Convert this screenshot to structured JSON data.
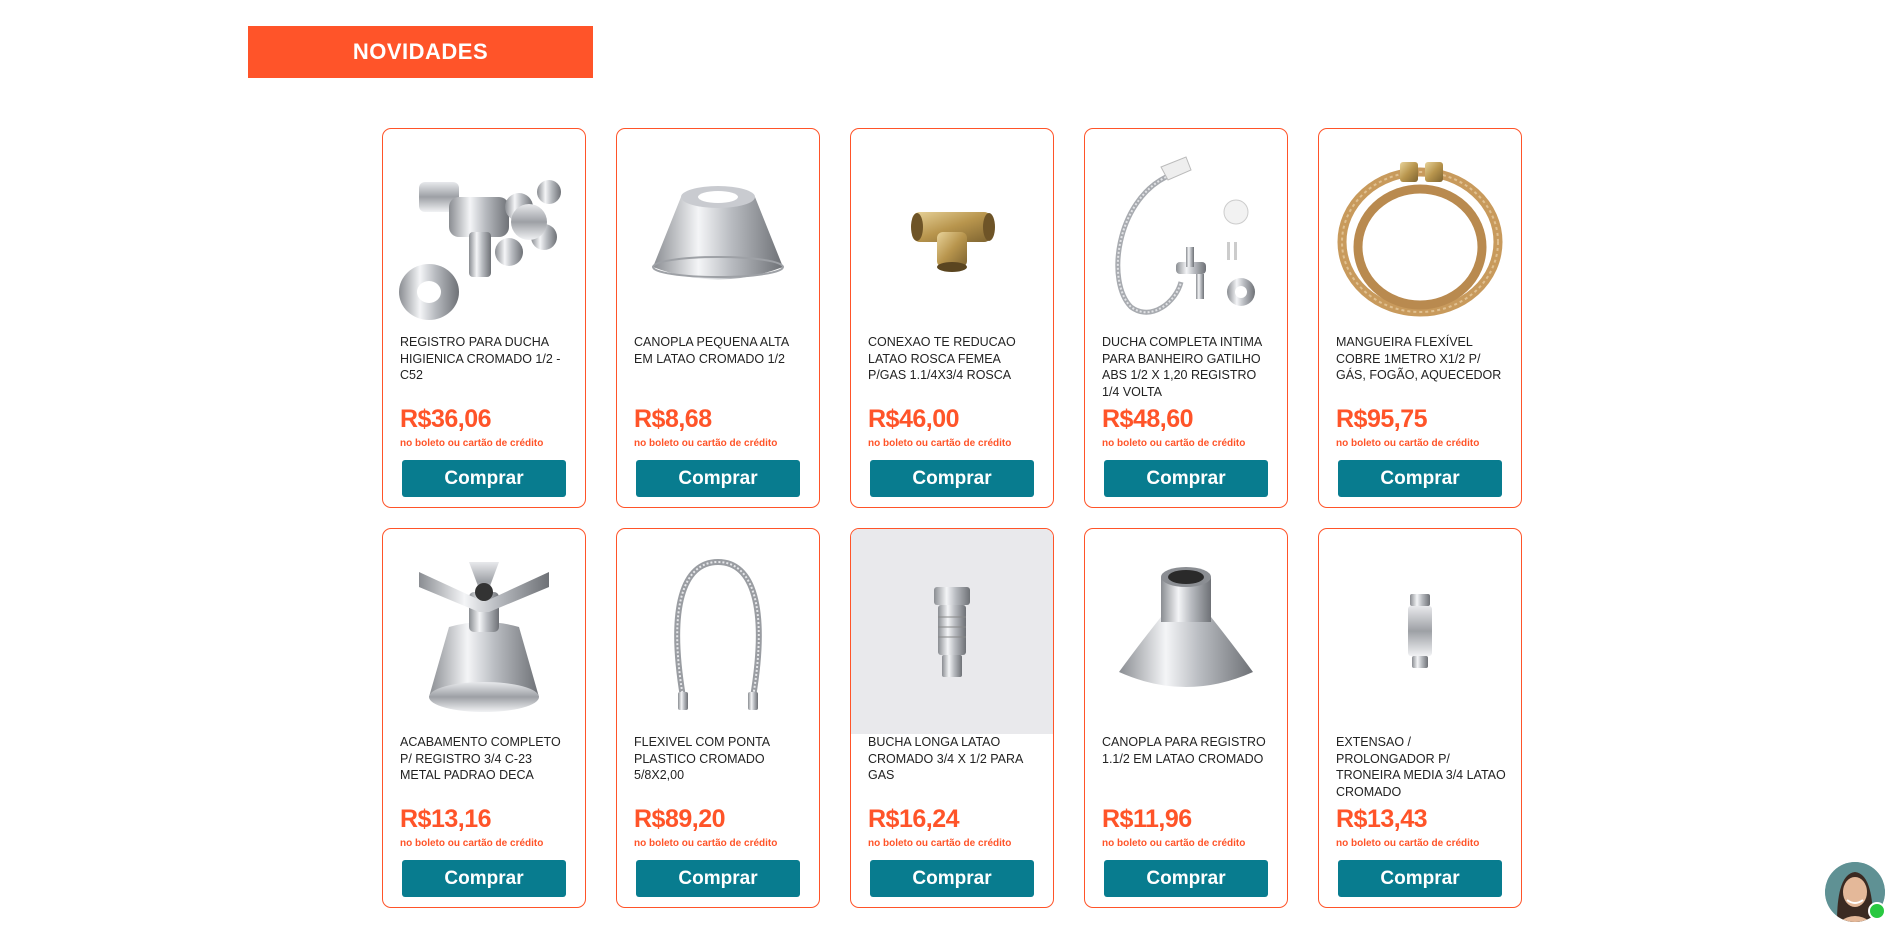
{
  "section": {
    "title": "NOVIDADES"
  },
  "colors": {
    "accent": "#ff5429",
    "button": "#087c8f"
  },
  "products": [
    {
      "name": "REGISTRO PARA DUCHA HIGIENICA CROMADO 1/2 - C52",
      "price": "R$36,06",
      "note": "no boleto ou cartão de crédito",
      "button": "Comprar",
      "icon": "chrome-valve-icon"
    },
    {
      "name": "CANOPLA PEQUENA ALTA EM LATAO CROMADO 1/2",
      "price": "R$8,68",
      "note": "no boleto ou cartão de crédito",
      "button": "Comprar",
      "icon": "canopla-icon"
    },
    {
      "name": "CONEXAO TE REDUCAO LATAO ROSCA FEMEA P/GAS 1.1/4X3/4 ROSCA",
      "price": "R$46,00",
      "note": "no boleto ou cartão de crédito",
      "button": "Comprar",
      "icon": "brass-tee-icon"
    },
    {
      "name": "DUCHA COMPLETA INTIMA PARA BANHEIRO GATILHO ABS 1/2 X 1,20 REGISTRO 1/4 VOLTA",
      "price": "R$48,60",
      "note": "no boleto ou cartão de crédito",
      "button": "Comprar",
      "icon": "hygienic-shower-icon"
    },
    {
      "name": "MANGUEIRA FLEXÍVEL COBRE 1METRO X1/2 P/ GÁS, FOGÃO, AQUECEDOR",
      "price": "R$95,75",
      "note": "no boleto ou cartão de crédito",
      "button": "Comprar",
      "icon": "copper-hose-icon"
    },
    {
      "name": "ACABAMENTO COMPLETO P/ REGISTRO 3/4 C-23 METAL PADRAO DECA",
      "price": "R$13,16",
      "note": "no boleto ou cartão de crédito",
      "button": "Comprar",
      "icon": "cross-handle-icon"
    },
    {
      "name": "FLEXIVEL COM PONTA PLASTICO CROMADO 5/8X2,00",
      "price": "R$89,20",
      "note": "no boleto ou cartão de crédito",
      "button": "Comprar",
      "icon": "flexible-hose-icon"
    },
    {
      "name": "BUCHA LONGA LATAO CROMADO 3/4 X 1/2 PARA GAS",
      "price": "R$16,24",
      "note": "no boleto ou cartão de crédito",
      "button": "Comprar",
      "icon": "bushing-icon"
    },
    {
      "name": "CANOPLA PARA REGISTRO 1.1/2 EM LATAO CROMADO",
      "price": "R$11,96",
      "note": "no boleto ou cartão de crédito",
      "button": "Comprar",
      "icon": "canopla-large-icon"
    },
    {
      "name": "EXTENSAO / PROLONGADOR P/ TRONEIRA MEDIA 3/4 LATAO CROMADO",
      "price": "R$13,43",
      "note": "no boleto ou cartão de crédito",
      "button": "Comprar",
      "icon": "extension-icon"
    }
  ],
  "chat": {
    "status": "online"
  }
}
